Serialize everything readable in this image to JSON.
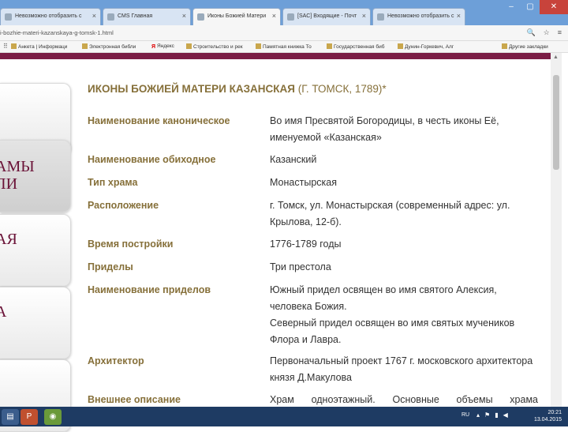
{
  "browser": {
    "tabs": [
      {
        "label": "Невозможно отобразить с"
      },
      {
        "label": "CMS Главная"
      },
      {
        "label": "Иконы Божией Матери"
      },
      {
        "label": "[SAC] Входящие - Почт"
      },
      {
        "label": "Невозможно отобразить с"
      }
    ],
    "url": "i-bozhie-materi-kazanskaya-g-tomsk-1.html",
    "bookmarks": [
      {
        "label": "Анкета | Информаци"
      },
      {
        "label": "Электронная библи"
      },
      {
        "label": "Яндекс",
        "icon": "Я"
      },
      {
        "label": "Строительство и рек"
      },
      {
        "label": "Памятная книжка То"
      },
      {
        "label": "Государственная биб"
      },
      {
        "label": "Дунин-Горкевич, Алг"
      },
      {
        "label": "Другие закладки"
      }
    ]
  },
  "sidebar": {
    "items": [
      {
        "label": ""
      },
      {
        "label": "АМЫ\nЛИ"
      },
      {
        "label": "АЯ"
      },
      {
        "label": "А"
      },
      {
        "label": ""
      }
    ]
  },
  "page": {
    "title": "ИКОНЫ БОЖИЕЙ МАТЕРИ КАЗАНСКАЯ",
    "title_suffix": " (Г. ТОМСК, 1789)*",
    "rows": [
      {
        "label": "Наименование каноническое",
        "value": "Во имя Пресвятой Богородицы, в честь иконы Её, именуемой «Казанская»"
      },
      {
        "label": "Наименование обиходное",
        "value": "Казанский"
      },
      {
        "label": "Тип храма",
        "value": "Монастырская"
      },
      {
        "label": "Расположение",
        "value": "г. Томск, ул. Монастырская (современный адрес: ул. Крылова, 12-б)."
      },
      {
        "label": "Время постройки",
        "value": "1776-1789 годы"
      },
      {
        "label": "Приделы",
        "value": "Три престола"
      },
      {
        "label": "Наименование приделов",
        "value": "Южный придел освящен во имя святого Алексия, человека Божия.",
        "value2": "Северный придел освящен во имя святых мучеников Флора и Лавра."
      },
      {
        "label": "Архитектор",
        "value": "Первоначальный проект 1767 г. московского архитектора князя Д.Макулова"
      },
      {
        "label": "Внешнее описание",
        "value": "Храм одноэтажный. Основные объемы храма"
      }
    ]
  },
  "taskbar": {
    "lang": "RU",
    "time": "20:21",
    "date": "13.04.2015"
  },
  "colors": {
    "accent": "#7a1d45",
    "label": "#86703a",
    "tabbar": "#6d9fd8",
    "taskbar": "#1e3b63"
  }
}
